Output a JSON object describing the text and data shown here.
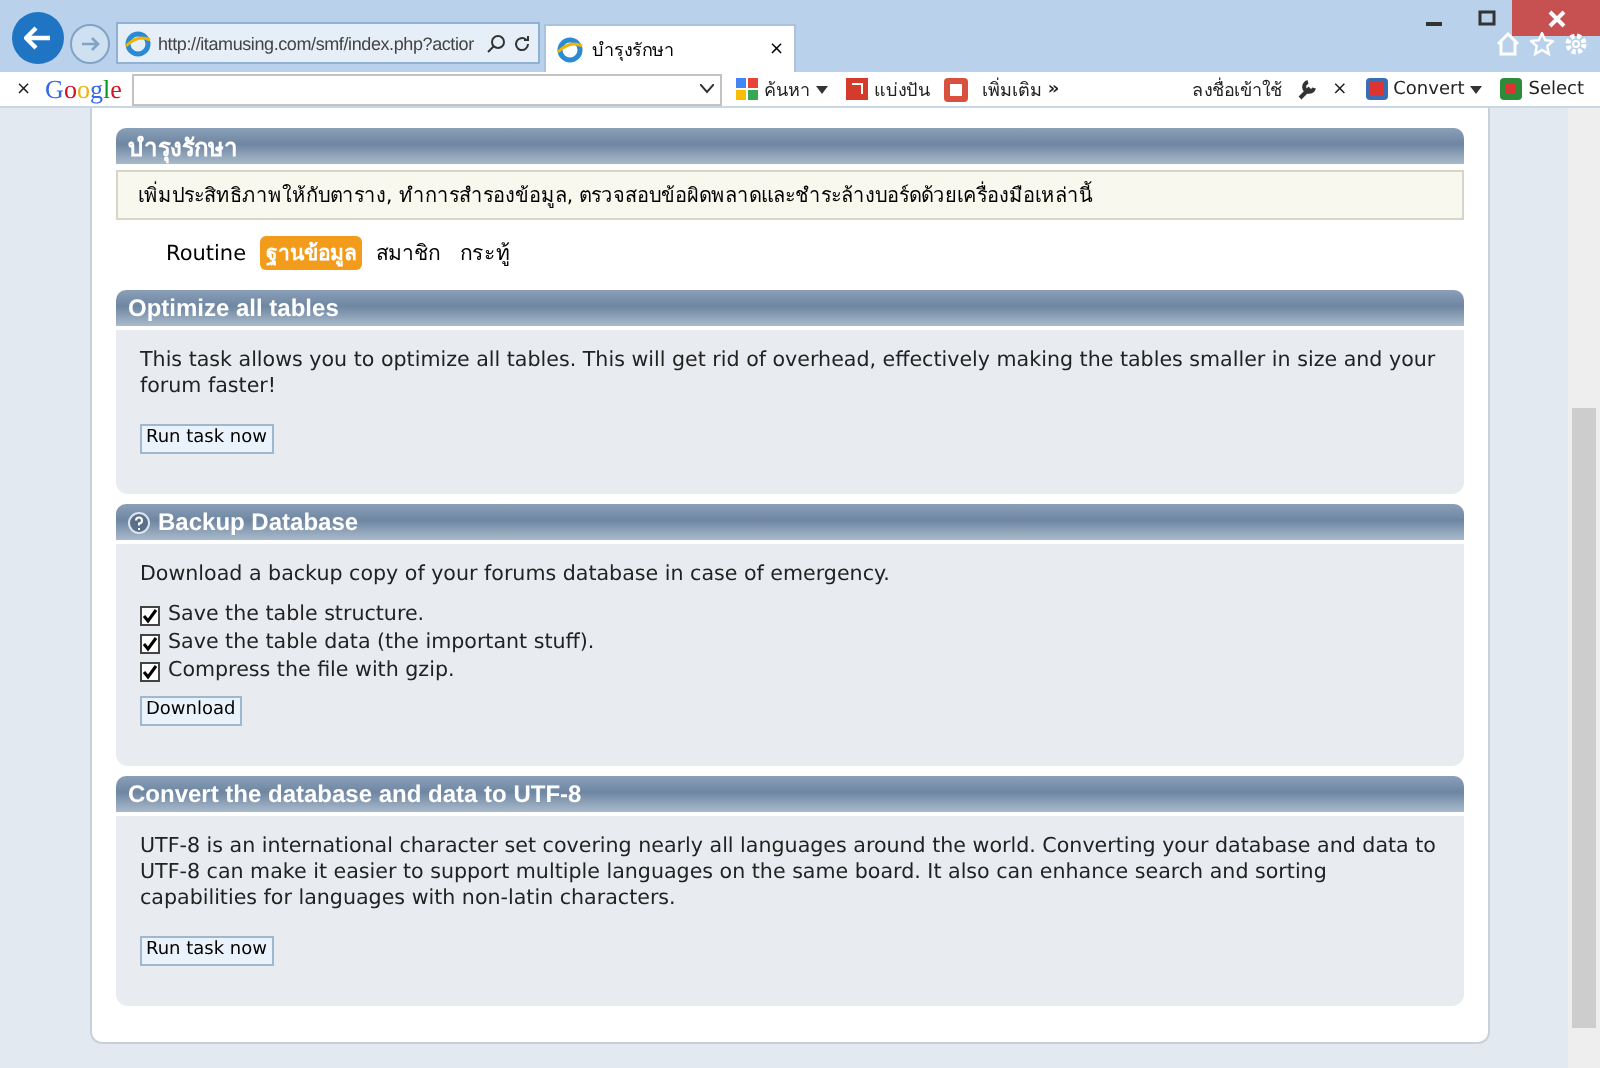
{
  "browser": {
    "address": "http://itamusing.com/smf/index.php?actior",
    "tab_title": "บำรุงรักษา",
    "tab_close": "×"
  },
  "toolbar": {
    "close": "×",
    "logo": "Google",
    "search_button": "ค้นหา",
    "share": "แบ่งปัน",
    "more": "เพิ่มเติม",
    "more_glyph": "»",
    "sign_in": "ลงชื่อเข้าใช้",
    "close_right": "×",
    "convert": "Convert",
    "select": "Select"
  },
  "page": {
    "title": "บำรุงรักษา",
    "description": "เพิ่มประสิทธิภาพให้กับตาราง, ทำการสำรองข้อมูล, ตรวจสอบข้อผิดพลาดและชำระล้างบอร์ดด้วยเครื่องมือเหล่านี้",
    "subtabs": [
      {
        "label": "Routine",
        "selected": false
      },
      {
        "label": "ฐานข้อมูล",
        "selected": true
      },
      {
        "label": "สมาชิก",
        "selected": false
      },
      {
        "label": "กระทู้",
        "selected": false
      }
    ],
    "sections": [
      {
        "title": "Optimize all tables",
        "help": false,
        "text": "This task allows you to optimize all tables. This will get rid of overhead, effectively making the tables smaller in size and your forum faster!",
        "button": "Run task now"
      },
      {
        "title": "Backup Database",
        "help": true,
        "text": "Download a backup copy of your forums database in case of emergency.",
        "options": [
          {
            "label": "Save the table structure.",
            "checked": true
          },
          {
            "label": "Save the table data (the important stuff).",
            "checked": true
          },
          {
            "label": "Compress the file with gzip.",
            "checked": true
          }
        ],
        "button": "Download"
      },
      {
        "title": "Convert the database and data to UTF-8",
        "help": false,
        "text": "UTF-8 is an international character set covering nearly all languages around the world. Converting your database and data to UTF-8 can make it easier to support multiple languages on the same board. It also can enhance search and sorting capabilities for languages with non-latin characters.",
        "button": "Run task now"
      }
    ]
  }
}
